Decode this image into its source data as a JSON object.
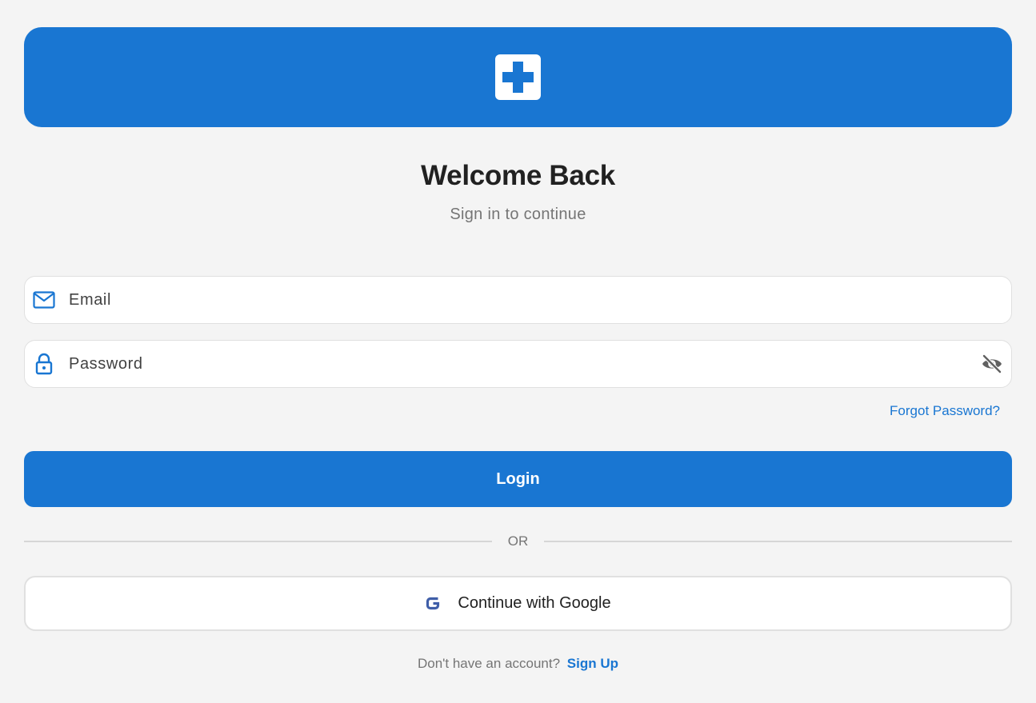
{
  "colors": {
    "primary": "#1976d2",
    "background": "#f4f4f4",
    "text_primary": "#212121",
    "text_secondary": "#757575"
  },
  "header": {
    "logo_icon": "medical-cross-icon"
  },
  "title": "Welcome Back",
  "subtitle": "Sign in to continue",
  "email": {
    "icon": "mail-icon",
    "placeholder": "Email",
    "value": ""
  },
  "password": {
    "icon": "lock-icon",
    "placeholder": "Password",
    "value": "",
    "toggle_icon": "visibility-off-icon"
  },
  "forgot_password": "Forgot Password?",
  "login_label": "Login",
  "divider_text": "OR",
  "google": {
    "icon": "google-icon",
    "label": "Continue with Google"
  },
  "signup": {
    "prompt": "Don't have an account?",
    "link": "Sign Up"
  }
}
